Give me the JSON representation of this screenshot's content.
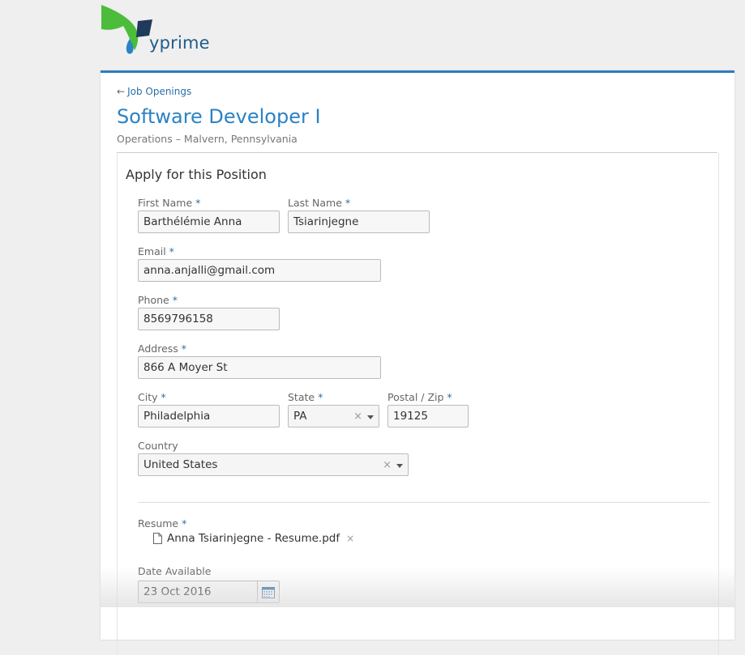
{
  "brand": {
    "name": "yprime"
  },
  "nav": {
    "back_label": "Job Openings",
    "back_arrow": "arrow-left-icon"
  },
  "job": {
    "title": "Software Developer I",
    "location": "Operations – Malvern, Pennsylvania"
  },
  "form": {
    "section_title": "Apply for this Position",
    "required_marker": "*",
    "first_name": {
      "label": "First Name",
      "value": "Barthélémie Anna"
    },
    "last_name": {
      "label": "Last Name",
      "value": "Tsiarinjegne"
    },
    "email": {
      "label": "Email",
      "value": "anna.anjalli@gmail.com"
    },
    "phone": {
      "label": "Phone",
      "value": "8569796158"
    },
    "address": {
      "label": "Address",
      "value": "866 A Moyer St"
    },
    "city": {
      "label": "City",
      "value": "Philadelphia"
    },
    "state": {
      "label": "State",
      "value": "PA"
    },
    "postal": {
      "label": "Postal / Zip",
      "value": "19125"
    },
    "country": {
      "label": "Country",
      "value": "United States"
    },
    "clear_glyph": "×",
    "resume": {
      "label": "Resume",
      "file_name": "Anna Tsiarinjegne - Resume.pdf",
      "remove_glyph": "×"
    },
    "date_available": {
      "label": "Date Available",
      "value": "23 Oct 2016"
    }
  },
  "colors": {
    "accent": "#2b82c4",
    "link": "#2b6ea8",
    "logo_green": "#4cbd3a",
    "logo_navy": "#1f3a5a"
  }
}
